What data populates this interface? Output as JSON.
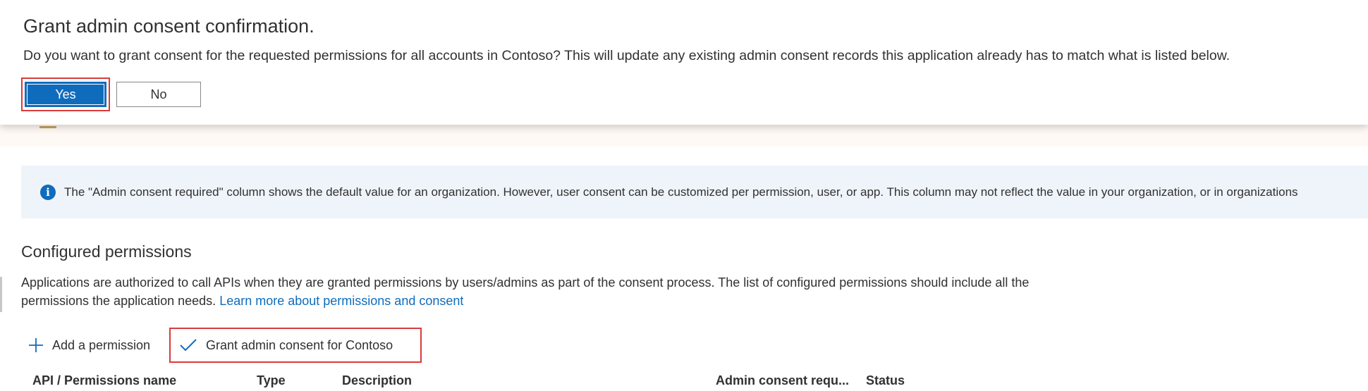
{
  "dialog": {
    "title": "Grant admin consent confirmation.",
    "message": "Do you want to grant consent for the requested permissions for all accounts in Contoso? This will update any existing admin consent records this application already has to match what is listed below.",
    "yes_label": "Yes",
    "no_label": "No"
  },
  "info_bar": {
    "text": "The \"Admin consent required\" column shows the default value for an organization. However, user consent can be customized per permission, user, or app. This column may not reflect the value in your organization, or in organizations"
  },
  "configured": {
    "title": "Configured permissions",
    "description": "Applications are authorized to call APIs when they are granted permissions by users/admins as part of the consent process. The list of configured permissions should include all the permissions the application needs.",
    "learn_more": "Learn more about permissions and consent"
  },
  "toolbar": {
    "add_label": "Add a permission",
    "grant_label": "Grant admin consent for Contoso"
  },
  "table": {
    "columns": [
      "API / Permissions name",
      "Type",
      "Description",
      "Admin consent requ...",
      "Status"
    ]
  }
}
